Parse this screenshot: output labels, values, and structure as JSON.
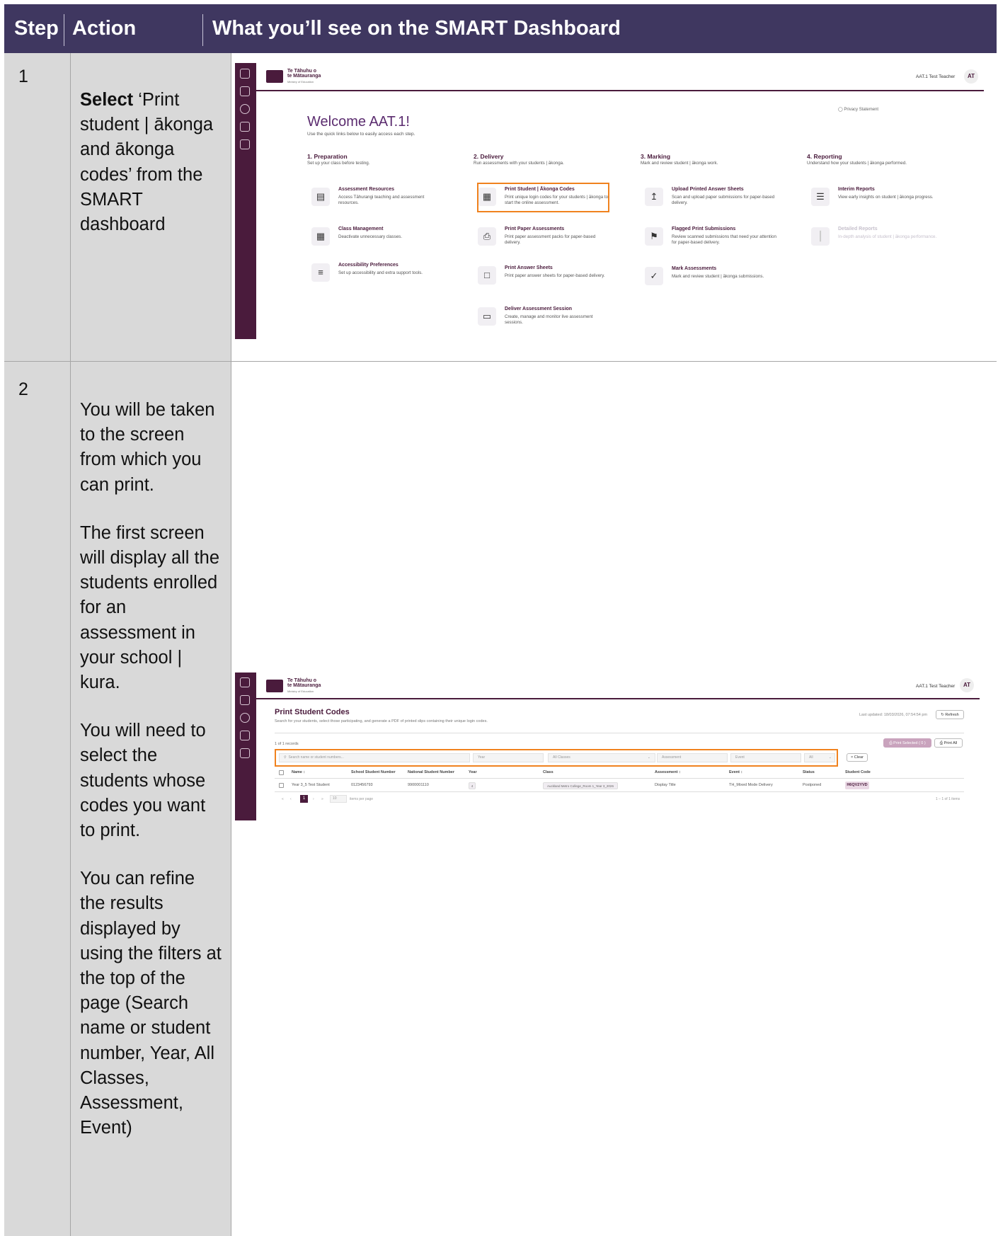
{
  "header": {
    "step": "Step",
    "action": "Action",
    "main": "What you’ll see on the SMART Dashboard"
  },
  "steps": [
    {
      "number": "1",
      "action_bold": "Select",
      "action_text": " ‘Print student | ākonga and ākonga codes’ from the SMART dashboard"
    },
    {
      "number": "2",
      "paragraphs": [
        "You will be taken to the screen from which you can print.",
        "The first screen will display all the students enrolled for an assessment in your school | kura.",
        "You will need to select the students whose codes you want to print.",
        "You can refine the results displayed by using the filters at the top of the page (Search name or student number, Year, All Classes, Assessment, Event)"
      ]
    }
  ],
  "screenshot1": {
    "logo_line1": "Te Tāhuhu o",
    "logo_line2": "te Mātauranga",
    "logo_sub": "Ministry of Education",
    "user": "AAT.1 Test Teacher",
    "avatar": "AT",
    "privacy": "Privacy Statement",
    "welcome": "Welcome AAT.1!",
    "welcome_sub": "Use the quick links below to easily access each step.",
    "sections": [
      {
        "title": "1. Preparation",
        "subtitle": "Set up your class before testing.",
        "cards": [
          {
            "title": "Assessment Resources",
            "desc": "Access Tāhurangi teaching and assessment resources.",
            "icon": "▤"
          },
          {
            "title": "Class Management",
            "desc": "Deactivate unnecessary classes.",
            "icon": "▦"
          },
          {
            "title": "Accessibility Preferences",
            "desc": "Set up accessibility and extra support tools.",
            "icon": "≡"
          }
        ]
      },
      {
        "title": "2. Delivery",
        "subtitle": "Run assessments with your students | ākonga.",
        "cards": [
          {
            "title": "Print Student | Ākonga Codes",
            "desc": "Print unique login codes for your students | ākonga to start the online assessment.",
            "icon": "▦"
          },
          {
            "title": "Print Paper Assessments",
            "desc": "Print paper assessment packs for paper-based delivery.",
            "icon": "⎙"
          },
          {
            "title": "Print Answer Sheets",
            "desc": "Print paper answer sheets for paper-based delivery.",
            "icon": "□"
          },
          {
            "title": "Deliver Assessment Session",
            "desc": "Create, manage and monitor live assessment sessions.",
            "icon": "▭"
          }
        ]
      },
      {
        "title": "3. Marking",
        "subtitle": "Mark and review student | ākonga work.",
        "cards": [
          {
            "title": "Upload Printed Answer Sheets",
            "desc": "Scan and upload paper submissions for paper-based delivery.",
            "icon": "↥"
          },
          {
            "title": "Flagged Print Submissions",
            "desc": "Review scanned submissions that need your attention for paper-based delivery.",
            "icon": "⚑"
          },
          {
            "title": "Mark Assessments",
            "desc": "Mark and review student | ākonga submissions.",
            "icon": "✓"
          }
        ]
      },
      {
        "title": "4. Reporting",
        "subtitle": "Understand how your students | ākonga performed.",
        "cards": [
          {
            "title": "Interim Reports",
            "desc": "View early insights on student | ākonga progress.",
            "icon": "☰"
          },
          {
            "title": "Detailed Reports",
            "desc": "In-depth analysis of student | ākonga performance.",
            "icon": "┃"
          }
        ]
      }
    ]
  },
  "screenshot2": {
    "logo_line1": "Te Tāhuhu o",
    "logo_line2": "te Mātauranga",
    "logo_sub": "Ministry of Education",
    "user": "AAT.1 Test Teacher",
    "avatar": "AT",
    "title": "Print Student Codes",
    "subtitle": "Search for your students, select those participating, and generate a PDF of printed slips containing their unique login codes.",
    "last_updated": "Last updated: 18/03/2026, 07:54:54 pm",
    "refresh": "↻ Refresh",
    "records": "1 of 1 records",
    "print_selected": "⎙ Print Selected ( 0 )",
    "print_all": "⎙ Print All",
    "filters": {
      "search": "Search name or student numbers...",
      "year": "Year",
      "classes": "All Classes",
      "assessment": "Assessment",
      "event": "Event",
      "status": "All",
      "clear": "× Clear"
    },
    "columns": [
      "Name ↕",
      "School Student Number",
      "National Student Number",
      "Year",
      "Class",
      "Assessment ↕",
      "Event ↕",
      "Status",
      "Student Code"
    ],
    "rows": [
      {
        "name": "Year 3_5 Test Student",
        "ssn": "0123456793",
        "nsn": "9900001110",
        "year": "4",
        "class": "Auckland Metro College_Room 1_Year 3_2026",
        "assessment": "Display Title",
        "event": "TH_Mixed Mode Delivery",
        "status": "Postponed",
        "code": "H6QV2YVD"
      }
    ],
    "page": "1",
    "per_page": "10",
    "per_page_label": "items per page",
    "range": "1 – 1 of 1 items"
  }
}
